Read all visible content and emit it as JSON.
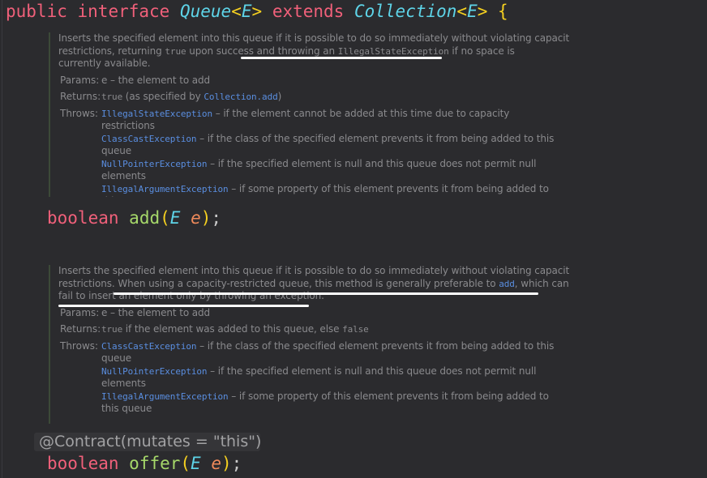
{
  "header": {
    "kw_public": "public",
    "kw_interface": "interface",
    "name": "Queue",
    "lt1": "<",
    "tparam1": "E",
    "gt1": ">",
    "kw_extends": "extends",
    "super": "Collection",
    "lt2": "<",
    "tparam2": "E",
    "gt2": ">",
    "brace": "{"
  },
  "docs": [
    {
      "lines": [
        [
          {
            "t": "Inserts the specified element into this queue if it is possible to do so immediately without violating capacity",
            "k": "t"
          }
        ],
        [
          {
            "t": "restrictions, returning ",
            "k": "t"
          },
          {
            "t": "true",
            "k": "c"
          },
          {
            "t": " upon success and throwing an ",
            "k": "t"
          },
          {
            "t": "IllegalStateException",
            "k": "c"
          },
          {
            "t": " if no space is",
            "k": "t"
          }
        ],
        [
          {
            "t": "currently available.",
            "k": "t"
          }
        ]
      ],
      "params_label": "Params:",
      "params": [
        {
          "t": "e – the element to add",
          "k": "t"
        }
      ],
      "returns_label": "Returns:",
      "returns": [
        {
          "t": "true",
          "k": "c"
        },
        {
          "t": " (as specified by ",
          "k": "t"
        },
        {
          "t": "Collection.add",
          "k": "l"
        },
        {
          "t": ")",
          "k": "t"
        }
      ],
      "throws_label": "Throws:",
      "throws": [
        [
          {
            "t": "IllegalStateException",
            "k": "l"
          },
          {
            "t": " – if the element cannot be added at this time due to capacity",
            "k": "t"
          }
        ],
        [
          {
            "t": "restrictions",
            "k": "t"
          }
        ],
        [
          {
            "t": "ClassCastException",
            "k": "l"
          },
          {
            "t": " – if the class of the specified element prevents it from being added to this",
            "k": "t"
          }
        ],
        [
          {
            "t": "queue",
            "k": "t"
          }
        ],
        [
          {
            "t": "NullPointerException",
            "k": "l"
          },
          {
            "t": " – if the specified element is null and this queue does not permit null",
            "k": "t"
          }
        ],
        [
          {
            "t": "elements",
            "k": "t"
          }
        ],
        [
          {
            "t": "IllegalArgumentException",
            "k": "l"
          },
          {
            "t": " – if some property of this element prevents it from being added to",
            "k": "t"
          }
        ],
        [
          {
            "t": "this queue",
            "k": "t"
          }
        ]
      ]
    },
    {
      "lines": [
        [
          {
            "t": "Inserts the specified element into this queue if it is possible to do so immediately without violating capacity",
            "k": "t"
          }
        ],
        [
          {
            "t": "restrictions. When using a capacity-restricted queue, this method is generally preferable to ",
            "k": "t"
          },
          {
            "t": "add",
            "k": "l"
          },
          {
            "t": ", which can",
            "k": "t"
          }
        ],
        [
          {
            "t": "fail to insert an element only by throwing an exception.",
            "k": "t"
          }
        ]
      ],
      "params_label": "Params:",
      "params": [
        {
          "t": "e – the element to add",
          "k": "t"
        }
      ],
      "returns_label": "Returns:",
      "returns": [
        {
          "t": "true",
          "k": "c"
        },
        {
          "t": " if the element was added to this queue, else ",
          "k": "t"
        },
        {
          "t": "false",
          "k": "c"
        }
      ],
      "throws_label": "Throws:",
      "throws": [
        [
          {
            "t": "ClassCastException",
            "k": "l"
          },
          {
            "t": " – if the class of the specified element prevents it from being added to this",
            "k": "t"
          }
        ],
        [
          {
            "t": "queue",
            "k": "t"
          }
        ],
        [
          {
            "t": "NullPointerException",
            "k": "l"
          },
          {
            "t": " – if the specified element is null and this queue does not permit null",
            "k": "t"
          }
        ],
        [
          {
            "t": "elements",
            "k": "t"
          }
        ],
        [
          {
            "t": "IllegalArgumentException",
            "k": "l"
          },
          {
            "t": " – if some property of this element prevents it from being added to",
            "k": "t"
          }
        ],
        [
          {
            "t": "this queue",
            "k": "t"
          }
        ]
      ]
    }
  ],
  "method_add": {
    "ret": "boolean",
    "name": "add",
    "open": "(",
    "ptype": "E",
    "pname": "e",
    "close": ")",
    "semi": ";"
  },
  "annotation": "@Contract(mutates = \"this\")",
  "method_offer": {
    "ret": "boolean",
    "name": "offer",
    "open": "(",
    "ptype": "E",
    "pname": "e",
    "close": ")",
    "semi": ";"
  },
  "colors": {
    "keyword": "#f0607a",
    "type": "#5ed4e8",
    "method": "#a6d86a",
    "param": "#f08a5a",
    "link": "#5a8ee0",
    "doc_text": "#8a8a8d",
    "highlight_underline": "#ffffff"
  }
}
